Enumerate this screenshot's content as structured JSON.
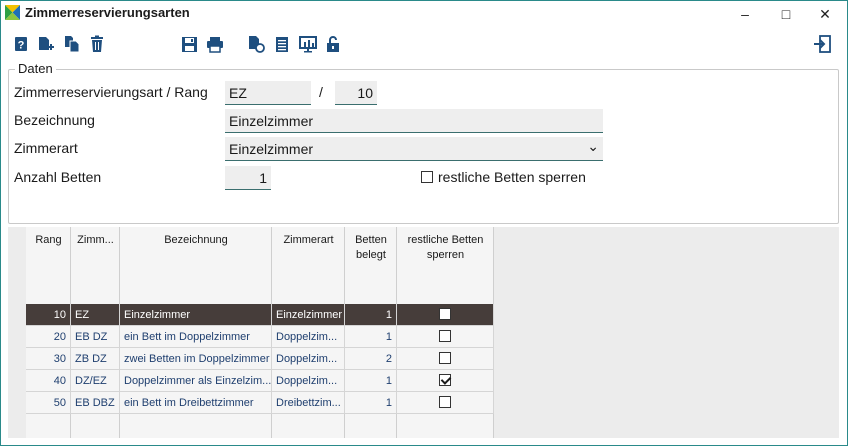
{
  "window": {
    "title": "Zimmerreservierungsarten",
    "minimize": "–",
    "maximize": "□",
    "close": "✕"
  },
  "toolbar": {
    "icons": [
      "help-icon",
      "new-record-icon",
      "copy-record-icon",
      "delete-icon",
      "save-icon",
      "print-icon",
      "refresh-icon",
      "list-icon",
      "chart-icon",
      "unlock-icon",
      "exit-icon"
    ]
  },
  "form": {
    "group_title": "Daten",
    "label_art_rang": "Zimmerreservierungsart / Rang",
    "art_value": "EZ",
    "slash": "/",
    "rang_value": "10",
    "label_bezeichnung": "Bezeichnung",
    "bezeichnung_value": "Einzelzimmer",
    "label_zimmerart": "Zimmerart",
    "zimmerart_value": "Einzelzimmer",
    "dropdown_arrow": "⌄",
    "label_anzahl_betten": "Anzahl Betten",
    "anzahl_betten_value": "1",
    "restliche_label": "restliche Betten sperren",
    "restliche_checked": false
  },
  "grid": {
    "headers": {
      "rang": "Rang",
      "zimm": "Zimm...",
      "bezeichnung": "Bezeichnung",
      "zimmerart": "Zimmerart",
      "betten_1": "Betten",
      "betten_2": "belegt",
      "restliche_1": "restliche Betten",
      "restliche_2": "sperren"
    },
    "rows": [
      {
        "rang": "10",
        "zimm": "EZ",
        "bezeichnung": "Einzelzimmer",
        "zimmerart": "Einzelzimmer",
        "betten": "1",
        "sperren": false,
        "selected": true
      },
      {
        "rang": "20",
        "zimm": "EB DZ",
        "bezeichnung": "ein Bett im Doppelzimmer",
        "zimmerart": "Doppelzim...",
        "betten": "1",
        "sperren": false,
        "selected": false
      },
      {
        "rang": "30",
        "zimm": "ZB DZ",
        "bezeichnung": "zwei Betten im Doppelzimmer",
        "zimmerart": "Doppelzim...",
        "betten": "2",
        "sperren": false,
        "selected": false
      },
      {
        "rang": "40",
        "zimm": "DZ/EZ",
        "bezeichnung": "Doppelzimmer als Einzelzim...",
        "zimmerart": "Doppelzim...",
        "betten": "1",
        "sperren": true,
        "selected": false
      },
      {
        "rang": "50",
        "zimm": "EB DBZ",
        "bezeichnung": "ein Bett im Dreibettzimmer",
        "zimmerart": "Dreibettzim...",
        "betten": "1",
        "sperren": false,
        "selected": false
      }
    ]
  },
  "colors": {
    "accent": "#2a8a8a",
    "selected_row": "#463d3a",
    "field_bg": "#eeeeee",
    "icon_blue": "#1f4f7f"
  }
}
